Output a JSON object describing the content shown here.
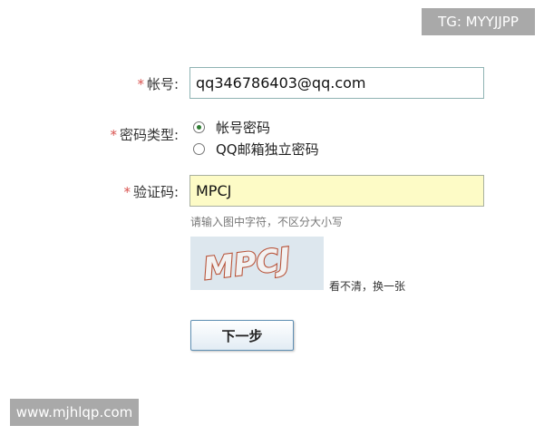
{
  "watermark_top": "TG: MYYJJPP",
  "watermark_bottom": "www.mjhlqp.com",
  "form": {
    "required_mark": "*",
    "account_label": "帐号:",
    "account_value": "qq346786403@qq.com",
    "password_type_label": "密码类型:",
    "password_options": [
      {
        "label": "帐号密码",
        "checked": true
      },
      {
        "label": "QQ邮箱独立密码",
        "checked": false
      }
    ],
    "captcha_label": "验证码:",
    "captcha_value": "MPCJ",
    "captcha_hint": "请输入图中字符，不区分大小写",
    "captcha_image_text": "MPCJ",
    "refresh_link": "看不清，换一张",
    "next_button": "下一步"
  }
}
